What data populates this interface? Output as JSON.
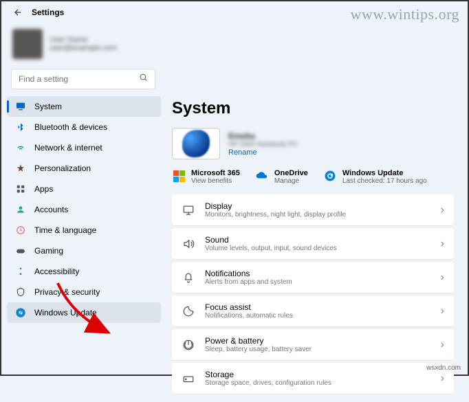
{
  "header": {
    "title": "Settings"
  },
  "profile": {
    "name": "User Name",
    "email": "user@example.com"
  },
  "search": {
    "placeholder": "Find a setting"
  },
  "sidebar": {
    "items": [
      {
        "label": "System"
      },
      {
        "label": "Bluetooth & devices"
      },
      {
        "label": "Network & internet"
      },
      {
        "label": "Personalization"
      },
      {
        "label": "Apps"
      },
      {
        "label": "Accounts"
      },
      {
        "label": "Time & language"
      },
      {
        "label": "Gaming"
      },
      {
        "label": "Accessibility"
      },
      {
        "label": "Privacy & security"
      },
      {
        "label": "Windows Update"
      }
    ]
  },
  "page": {
    "title": "System"
  },
  "device": {
    "name": "Emeka",
    "model": "HP 2000 Notebook PC",
    "rename": "Rename"
  },
  "status": {
    "m365": {
      "title": "Microsoft 365",
      "sub": "View benefits"
    },
    "onedrive": {
      "title": "OneDrive",
      "sub": "Manage"
    },
    "update": {
      "title": "Windows Update",
      "sub": "Last checked: 17 hours ago"
    }
  },
  "cards": [
    {
      "title": "Display",
      "sub": "Monitors, brightness, night light, display profile"
    },
    {
      "title": "Sound",
      "sub": "Volume levels, output, input, sound devices"
    },
    {
      "title": "Notifications",
      "sub": "Alerts from apps and system"
    },
    {
      "title": "Focus assist",
      "sub": "Notifications, automatic rules"
    },
    {
      "title": "Power & battery",
      "sub": "Sleep, battery usage, battery saver"
    },
    {
      "title": "Storage",
      "sub": "Storage space, drives, configuration rules"
    }
  ],
  "watermark": "www.wintips.org",
  "credit": "wsxdn.com"
}
